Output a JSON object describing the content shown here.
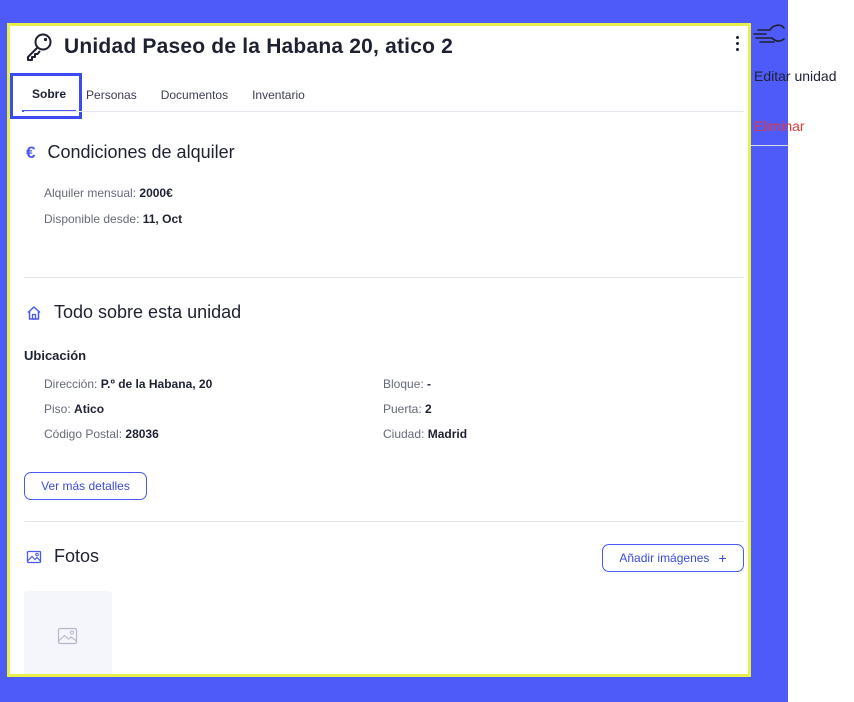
{
  "header": {
    "title": "Unidad Paseo de la Habana 20, atico 2"
  },
  "tabs": [
    {
      "label": "Sobre",
      "active": true
    },
    {
      "label": "Personas"
    },
    {
      "label": "Documentos"
    },
    {
      "label": "Inventario"
    }
  ],
  "rental": {
    "title": "Condiciones de alquiler",
    "icon": "euro-icon",
    "monthly_label": "Alquiler mensual:",
    "monthly_value": "2000€",
    "available_label": "Disponible desde:",
    "available_value": "11, Oct"
  },
  "unit": {
    "title": "Todo sobre esta unidad",
    "icon": "home-icon",
    "location_heading": "Ubicación",
    "address_label": "Dirección:",
    "address_value": "P.º de la Habana, 20",
    "floor_label": "Piso:",
    "floor_value": "Atico",
    "postal_label": "Código Postal:",
    "postal_value": "28036",
    "block_label": "Bloque:",
    "block_value": "-",
    "door_label": "Puerta:",
    "door_value": "2",
    "city_label": "Ciudad:",
    "city_value": "Madrid",
    "more_button": "Ver más detalles"
  },
  "photos": {
    "title": "Fotos",
    "icon": "image-icon",
    "add_button": "Añadir imágenes",
    "add_symbol": "+"
  },
  "menu": {
    "edit": "Editar unidad",
    "delete": "Eliminar"
  },
  "colors": {
    "background": "#4f5bf8",
    "highlight_border": "#e7f04a",
    "accent": "#4a58f5",
    "danger": "#e03c3c"
  }
}
